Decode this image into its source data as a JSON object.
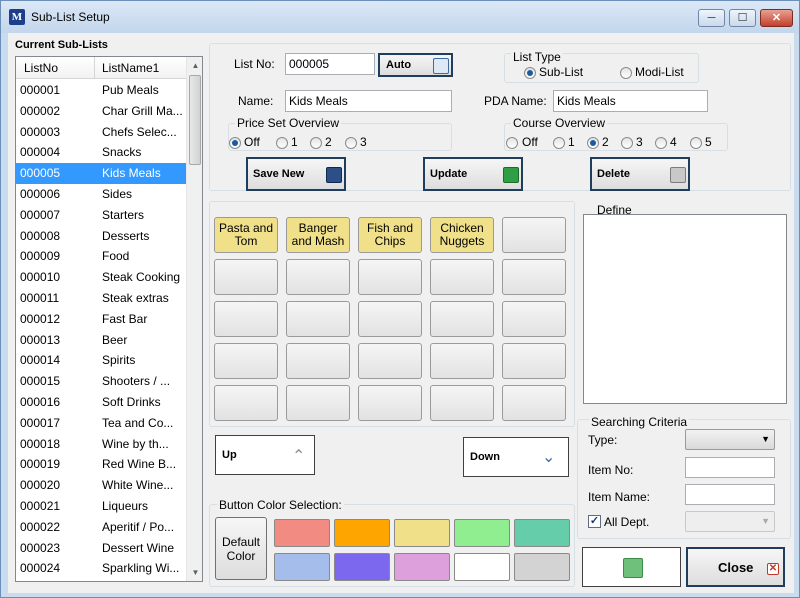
{
  "window": {
    "title": "Sub-List Setup",
    "app_icon_letter": "M"
  },
  "controls": {
    "minimize": "─",
    "maximize": "☐",
    "close": "✕"
  },
  "left": {
    "title": "Current Sub-Lists",
    "headers": [
      "ListNo",
      "ListName1"
    ],
    "rows": [
      {
        "no": "000001",
        "name": "Pub Meals"
      },
      {
        "no": "000002",
        "name": "Char Grill Ma..."
      },
      {
        "no": "000003",
        "name": "Chefs Selec..."
      },
      {
        "no": "000004",
        "name": "Snacks"
      },
      {
        "no": "000005",
        "name": "Kids Meals"
      },
      {
        "no": "000006",
        "name": "Sides"
      },
      {
        "no": "000007",
        "name": "Starters"
      },
      {
        "no": "000008",
        "name": "Desserts"
      },
      {
        "no": "000009",
        "name": "Food"
      },
      {
        "no": "000010",
        "name": "Steak Cooking"
      },
      {
        "no": "000011",
        "name": "Steak extras"
      },
      {
        "no": "000012",
        "name": "Fast Bar"
      },
      {
        "no": "000013",
        "name": "Beer"
      },
      {
        "no": "000014",
        "name": "Spirits"
      },
      {
        "no": "000015",
        "name": "Shooters / ..."
      },
      {
        "no": "000016",
        "name": "Soft Drinks"
      },
      {
        "no": "000017",
        "name": "Tea and Co..."
      },
      {
        "no": "000018",
        "name": "Wine by th..."
      },
      {
        "no": "000019",
        "name": "Red Wine B..."
      },
      {
        "no": "000020",
        "name": "White Wine..."
      },
      {
        "no": "000021",
        "name": "Liqueurs"
      },
      {
        "no": "000022",
        "name": "Aperitif / Po..."
      },
      {
        "no": "000023",
        "name": "Dessert Wine"
      },
      {
        "no": "000024",
        "name": "Sparkling Wi..."
      }
    ],
    "selected_index": 4
  },
  "form": {
    "list_no_label": "List No:",
    "list_no_value": "000005",
    "auto_label": "Auto",
    "list_type_label": "List Type",
    "list_type_options": [
      "Sub-List",
      "Modi-List"
    ],
    "list_type_selected": "Sub-List",
    "name_label": "Name:",
    "name_value": "Kids Meals",
    "pda_label": "PDA Name:",
    "pda_value": "Kids Meals",
    "price_set_label": "Price Set Overview",
    "price_set_options": [
      "Off",
      "1",
      "2",
      "3"
    ],
    "price_set_selected": "Off",
    "course_label": "Course Overview",
    "course_options": [
      "Off",
      "1",
      "2",
      "3",
      "4",
      "5"
    ],
    "course_selected": "2"
  },
  "actions": {
    "save_new": "Save New",
    "update": "Update",
    "delete": "Delete"
  },
  "grid": {
    "buttons": [
      "Pasta and Tom",
      "Banger and Mash",
      "Fish and Chips",
      "Chicken Nuggets",
      "",
      "",
      "",
      "",
      "",
      "",
      "",
      "",
      "",
      "",
      "",
      "",
      "",
      "",
      "",
      "",
      "",
      "",
      "",
      "",
      ""
    ],
    "filled_color": "#f0e08a",
    "up_label": "Up",
    "down_label": "Down"
  },
  "colors": {
    "label": "Button Color Selection:",
    "default_label": "Default Color",
    "swatches": [
      "#f28b82",
      "#ffa500",
      "#f0e08a",
      "#90ee90",
      "#66cdaa",
      "#a4bdea",
      "#7b68ee",
      "#dda0dd",
      "#ffffff",
      "#d3d3d3"
    ]
  },
  "define": {
    "label": "Define"
  },
  "search": {
    "label": "Searching Criteria",
    "type_label": "Type:",
    "item_no_label": "Item No:",
    "item_name_label": "Item Name:",
    "all_dept_label": "All Dept.",
    "all_dept_checked": true
  },
  "bottom": {
    "close_label": "Close"
  }
}
